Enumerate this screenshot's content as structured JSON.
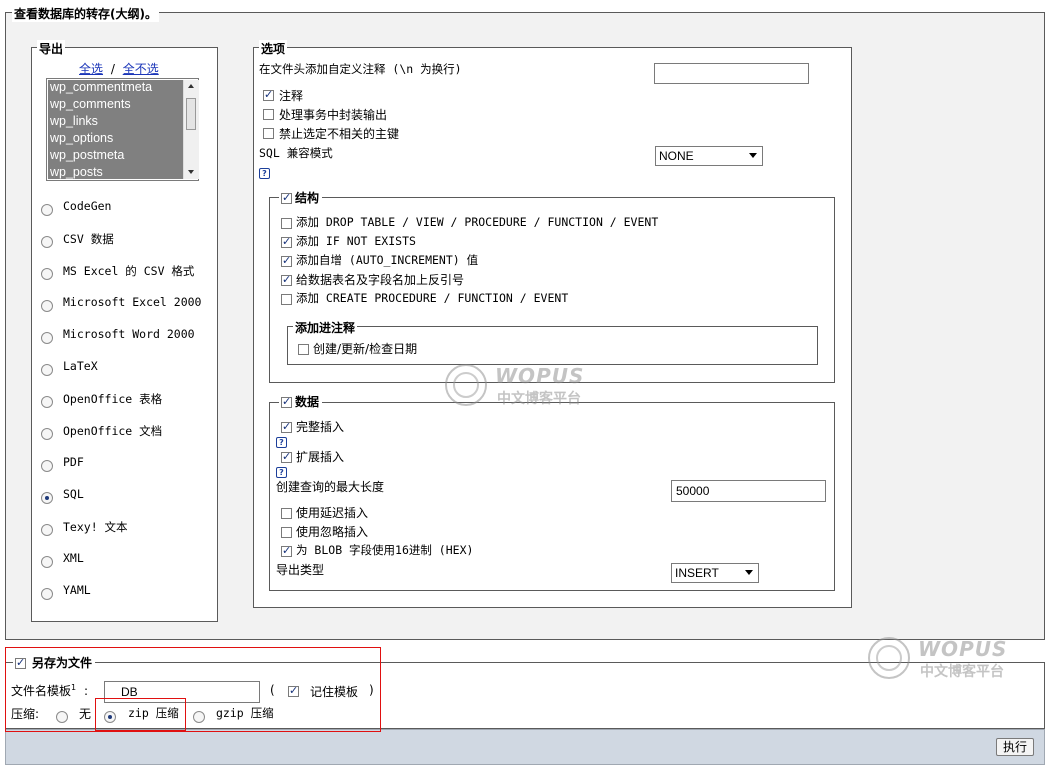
{
  "main_legend": "查看数据库的转存(大纲)。",
  "export": {
    "legend": "导出",
    "select_all": "全选",
    "separator": "/",
    "select_none": "全不选",
    "tables": [
      "wp_commentmeta",
      "wp_comments",
      "wp_links",
      "wp_options",
      "wp_postmeta",
      "wp_posts"
    ],
    "formats": [
      "CodeGen",
      "CSV 数据",
      "MS Excel 的 CSV 格式",
      "Microsoft Excel 2000",
      "Microsoft Word 2000",
      "LaTeX",
      "OpenOffice 表格",
      "OpenOffice 文档",
      "PDF",
      "SQL",
      "Texy! 文本",
      "XML",
      "YAML"
    ],
    "selected_format": "SQL"
  },
  "options": {
    "legend": "选项",
    "header_comment_label": "在文件头添加自定义注释 (\\n 为换行)",
    "header_comment_value": "",
    "comments_label": "注释",
    "transaction_label": "处理事务中封装输出",
    "disable_fk_label": "禁止选定不相关的主键",
    "compat_label": "SQL 兼容模式",
    "compat_value": "NONE",
    "help_glyph": "?",
    "structure": {
      "legend": "结构",
      "drop_table": "添加 DROP TABLE / VIEW / PROCEDURE / FUNCTION / EVENT",
      "if_not_exists": "添加 IF NOT EXISTS",
      "auto_increment": "添加自增 (AUTO_INCREMENT) 值",
      "backquotes": "给数据表名及字段名加上反引号",
      "create_procedure": "添加 CREATE PROCEDURE / FUNCTION / EVENT",
      "comments_legend": "添加进注释",
      "dates_label": "创建/更新/检查日期"
    },
    "data": {
      "legend": "数据",
      "complete_inserts": "完整插入",
      "extended_inserts": "扩展插入",
      "max_query_label": "创建查询的最大长度",
      "max_query_value": "50000",
      "delayed_inserts": "使用延迟插入",
      "ignore_inserts": "使用忽略插入",
      "hex_blob": "为 BLOB 字段使用16进制 (HEX)",
      "export_type_label": "导出类型",
      "export_type_value": "INSERT"
    }
  },
  "save": {
    "legend": "另存为文件",
    "filename_label": "文件名模板",
    "filename_sup": "1",
    "colon": ":",
    "filename_value": "DB",
    "paren_open": "(",
    "remember_label": "记住模板",
    "paren_close": ")",
    "compression_label": "压缩:",
    "none_label": "无",
    "zip_label": "zip 压缩",
    "gzip_label": "gzip 压缩",
    "selected_compression": "zip"
  },
  "go_button": "执行",
  "watermark": {
    "brand": "WOPUS",
    "subtitle": "中文博客平台"
  }
}
